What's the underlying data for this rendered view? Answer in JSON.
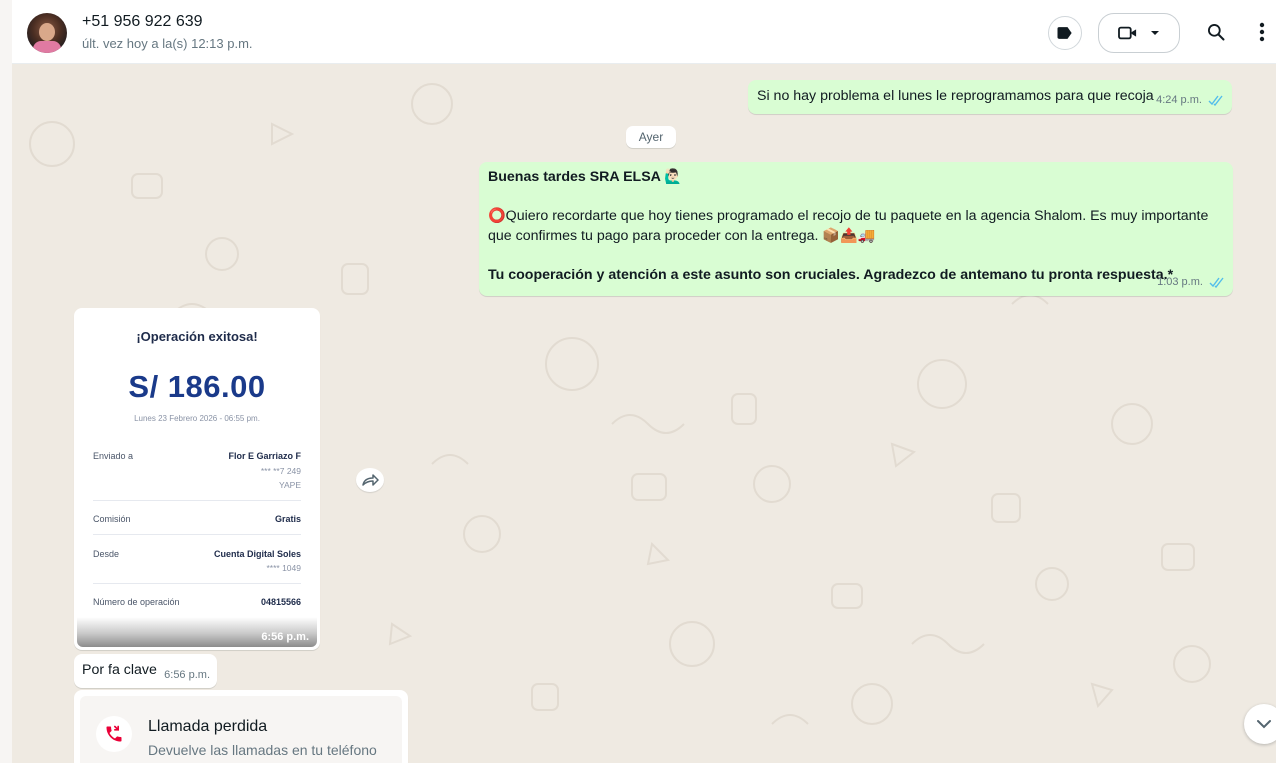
{
  "header": {
    "contact_name": "+51 956 922 639",
    "contact_status": "últ. vez hoy a la(s) 12:13 p.m."
  },
  "icons": {
    "label": "label-icon",
    "video": "video-camera-icon",
    "dropdown": "chevron-down-icon",
    "search": "search-icon",
    "menu": "more-vertical-icon",
    "read_ticks": "double-check-icon",
    "forward": "forward-icon",
    "missed_call": "missed-call-icon",
    "scroll_down": "chevron-down-icon"
  },
  "colors": {
    "outgoing_bubble": "#d9fdd3",
    "incoming_bubble": "#ffffff",
    "chat_background": "#efeae2",
    "read_tick": "#53bdeb",
    "missed_call": "#ea0038"
  },
  "messages": {
    "reschedule": {
      "text": "Si no hay problema el lunes le reprogramamos para que recoja",
      "time": "4:24 p.m."
    },
    "day_separator": "Ayer",
    "reminder": {
      "greeting": "Buenas tardes SRA ELSA",
      "greeting_emoji": "🙋🏻‍♂️",
      "circle_emoji": "⭕",
      "body": "Quiero recordarte que hoy tienes programado el recojo de tu paquete en la agencia Shalom. Es muy importante que confirmes tu pago para proceder con la entrega.",
      "body_emoji": "📦📤🚚",
      "closing": "Tu cooperación y atención a este asunto son cruciales. Agradezco de antemano tu pronta respuesta.*",
      "time": "1:03 p.m."
    },
    "receipt": {
      "title": "¡Operación exitosa!",
      "amount": "S/ 186.00",
      "date": "Lunes 23 Febrero 2026 - 06:55 pm.",
      "sent_to_label": "Enviado a",
      "sent_to_name": "Flor E Garriazo F",
      "sent_to_number": "*** **7 249",
      "sent_to_method": "YAPE",
      "commission_label": "Comisión",
      "commission_value": "Gratis",
      "from_label": "Desde",
      "from_account": "Cuenta Digital Soles",
      "from_number": "**** 1049",
      "operation_label": "Número de operación",
      "operation_number": "04815566",
      "time": "6:56 p.m."
    },
    "clave": {
      "text": "Por fa clave",
      "time": "6:56 p.m."
    },
    "missed_call": {
      "title": "Llamada perdida",
      "subtitle": "Devuelve las llamadas en tu teléfono"
    }
  }
}
